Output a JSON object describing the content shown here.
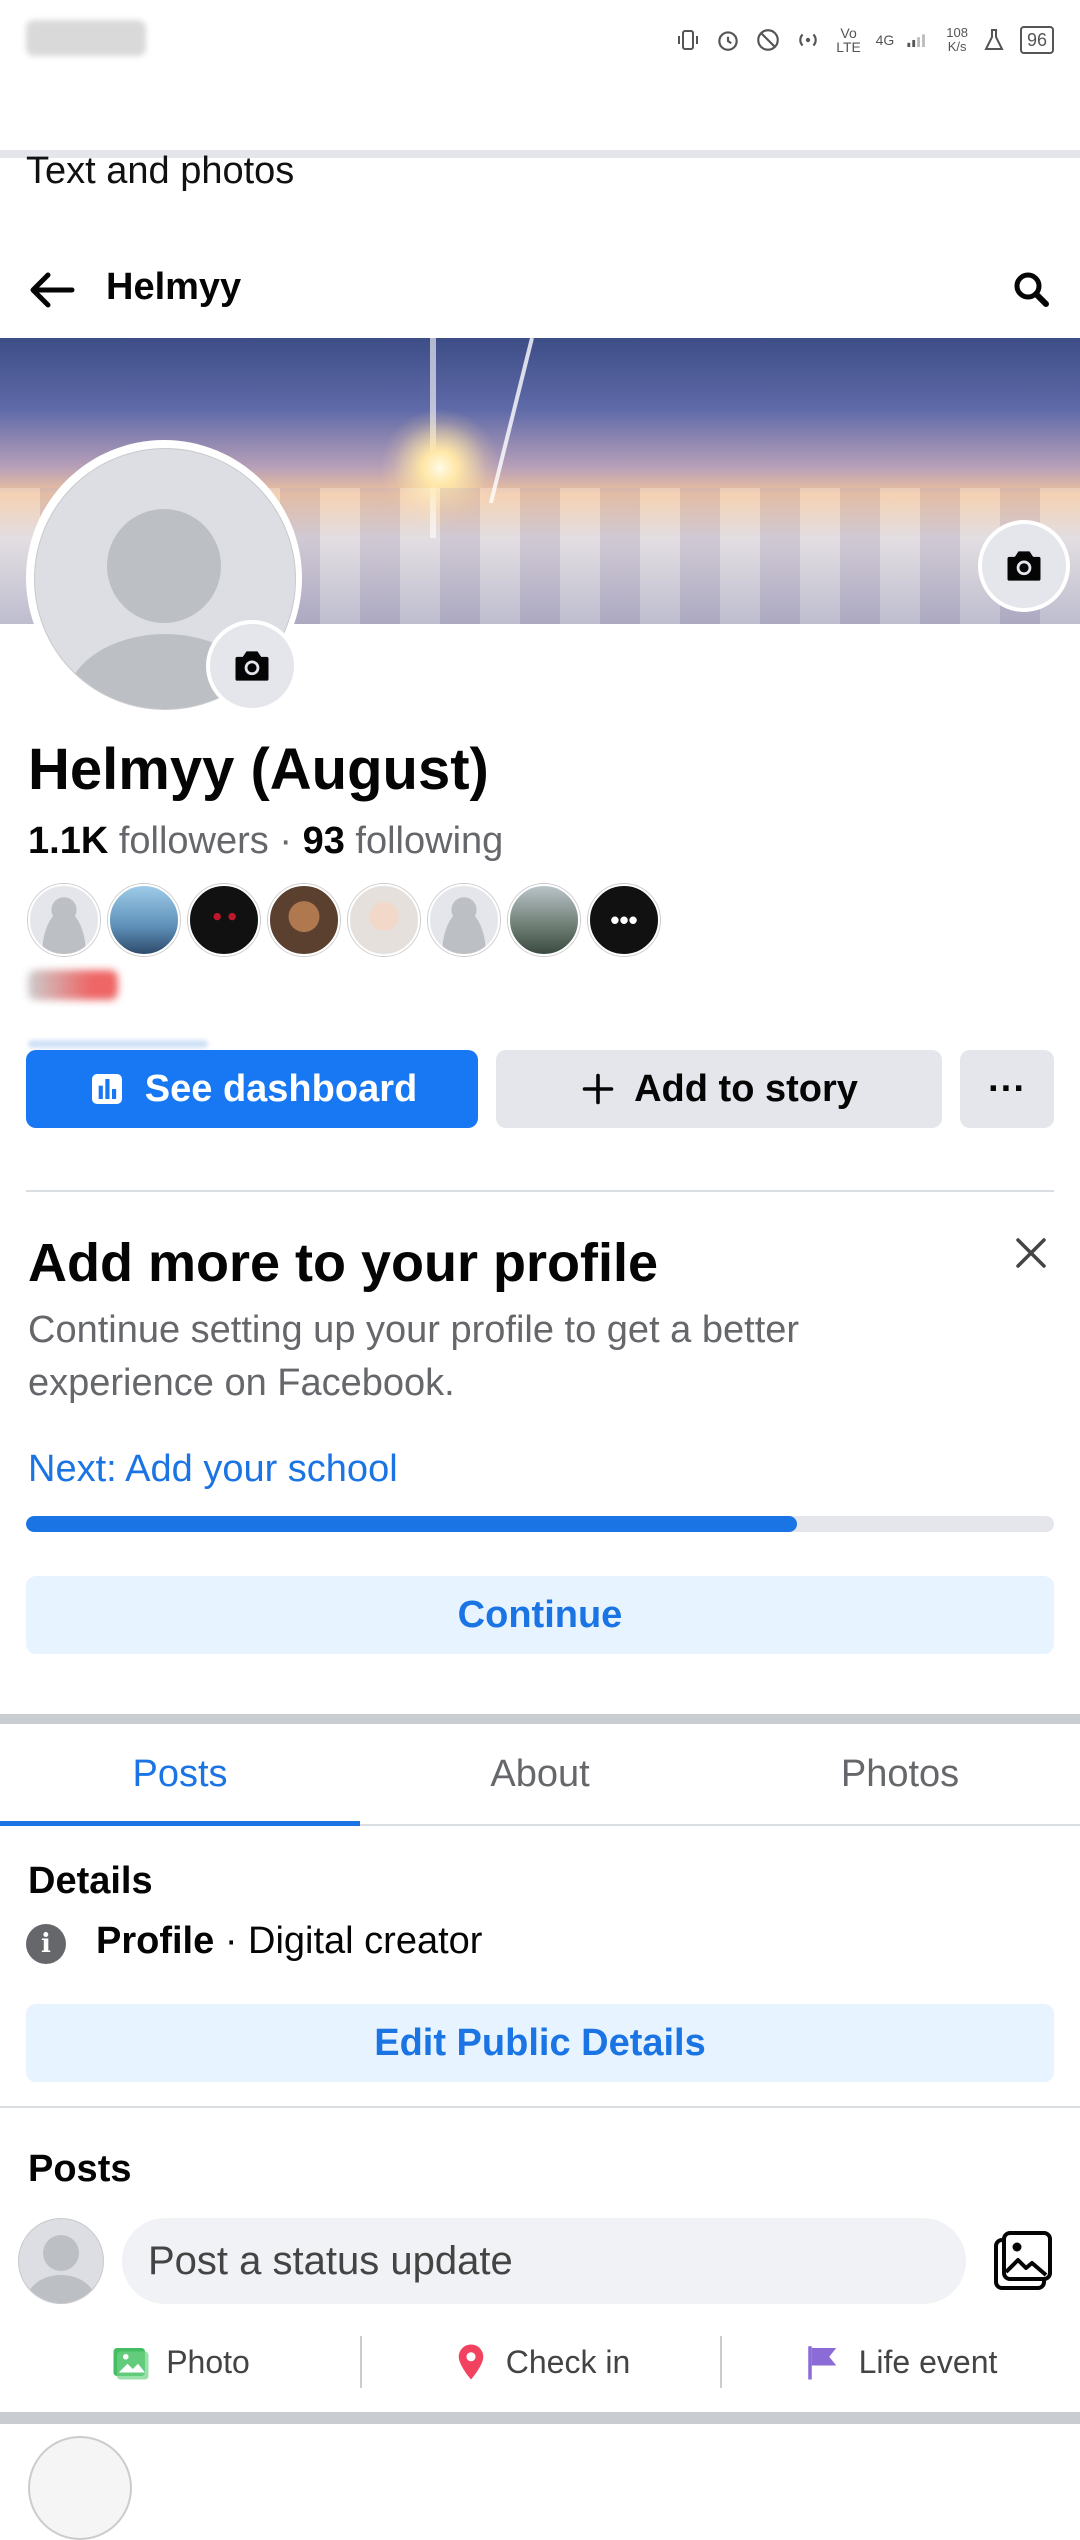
{
  "status_bar": {
    "speed_value": "108",
    "speed_unit": "K/s",
    "network": "4G",
    "volte": "Vo LTE",
    "battery": "96"
  },
  "top_cut_text": "Text and photos",
  "header": {
    "title": "Helmyy"
  },
  "profile": {
    "name": "Helmyy (August)",
    "followers_count": "1.1K",
    "followers_label": "followers",
    "separator": "·",
    "following_count": "93",
    "following_label": "following",
    "friend_count": 8
  },
  "actions": {
    "dashboard_label": "See dashboard",
    "story_label": "Add to story",
    "more_label": "···"
  },
  "add_more": {
    "title": "Add more to your profile",
    "description": "Continue setting up your profile to get a better experience on Facebook.",
    "next": "Next: Add your school",
    "progress_fraction": 0.75,
    "continue_label": "Continue"
  },
  "tabs": [
    {
      "label": "Posts",
      "active": true
    },
    {
      "label": "About",
      "active": false
    },
    {
      "label": "Photos",
      "active": false
    }
  ],
  "details": {
    "heading": "Details",
    "type_label": "Profile",
    "type_value": "Digital creator",
    "edit_label": "Edit Public Details"
  },
  "posts": {
    "heading": "Posts",
    "status_placeholder": "Post a status update",
    "actions": [
      {
        "label": "Photo",
        "icon": "photo-icon",
        "color": "#45bd62"
      },
      {
        "label": "Check in",
        "icon": "location-pin-icon",
        "color": "#f3425f"
      },
      {
        "label": "Life event",
        "icon": "flag-icon",
        "color": "#8b6bd6"
      }
    ]
  },
  "colors": {
    "accent": "#1877f2",
    "link": "#1b74e4",
    "light_accent": "#e7f3ff"
  }
}
